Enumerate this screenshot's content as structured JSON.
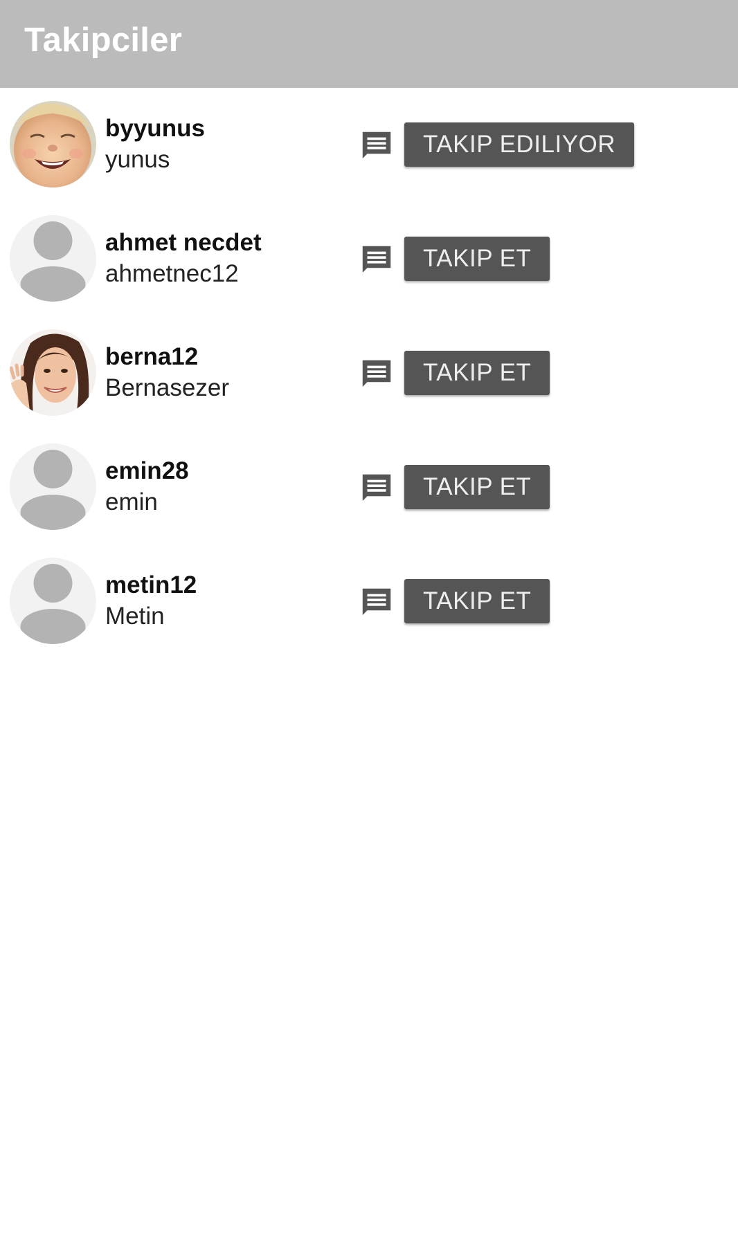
{
  "app_bar": {
    "title": "Takipciler",
    "background": "#bbbbbb"
  },
  "followers": [
    {
      "username": "byyunus",
      "fullname": "yunus",
      "avatar": "photo-baby-icon",
      "button_label": "TAKIP EDILIYOR",
      "message_icon": "message-icon"
    },
    {
      "username": "ahmet necdet",
      "fullname": "ahmetnec12",
      "avatar": "default-user-icon",
      "button_label": "TAKIP ET",
      "message_icon": "message-icon"
    },
    {
      "username": "berna12",
      "fullname": "Bernasezer",
      "avatar": "photo-woman-icon",
      "button_label": "TAKIP ET",
      "message_icon": "message-icon"
    },
    {
      "username": "emin28",
      "fullname": "emin",
      "avatar": "default-user-icon",
      "button_label": "TAKIP ET",
      "message_icon": "message-icon"
    },
    {
      "username": "metin12",
      "fullname": "Metin",
      "avatar": "default-user-icon",
      "button_label": "TAKIP ET",
      "message_icon": "message-icon"
    }
  ],
  "colors": {
    "button": "#555555",
    "button_text": "#eeeeee",
    "icon": "#555555",
    "placeholder_bg": "#f2f2f2",
    "placeholder_figure": "#b3b3b3"
  }
}
